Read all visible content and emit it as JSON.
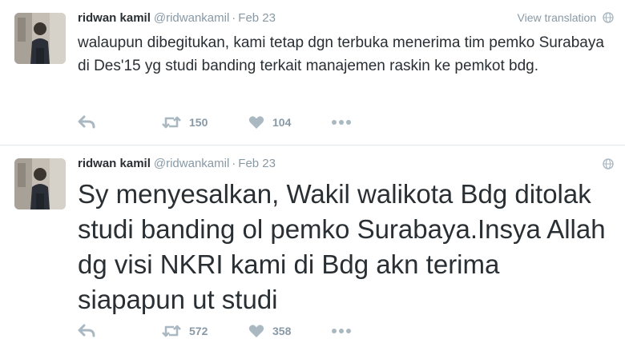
{
  "tweets": [
    {
      "fullname": "ridwan kamil",
      "handle": "@ridwankamil",
      "separator": "·",
      "timestamp": "Feb 23",
      "translate_label": "View translation",
      "text": "walaupun dibegitukan, kami tetap dgn terbuka menerima tim pemko Surabaya di Des'15 yg studi banding terkait manajemen raskin ke pemkot bdg.",
      "retweets": "150",
      "likes": "104",
      "icons": [
        "avatar",
        "globe-icon",
        "reply-icon",
        "retweet-icon",
        "heart-icon",
        "more-icon"
      ]
    },
    {
      "fullname": "ridwan kamil",
      "handle": "@ridwankamil",
      "separator": "·",
      "timestamp": "Feb 23",
      "text": "Sy menyesalkan, Wakil walikota Bdg ditolak studi banding ol pemko Surabaya.Insya Allah dg visi NKRI kami di Bdg akn terima siapapun ut studi",
      "retweets": "572",
      "likes": "358",
      "icons": [
        "avatar",
        "globe-icon",
        "reply-icon",
        "retweet-icon",
        "heart-icon",
        "more-icon"
      ]
    }
  ],
  "colors": {
    "text": "#292f33",
    "muted": "#8899a6",
    "icon": "#aab8c2",
    "divider": "#e1e8ed"
  }
}
